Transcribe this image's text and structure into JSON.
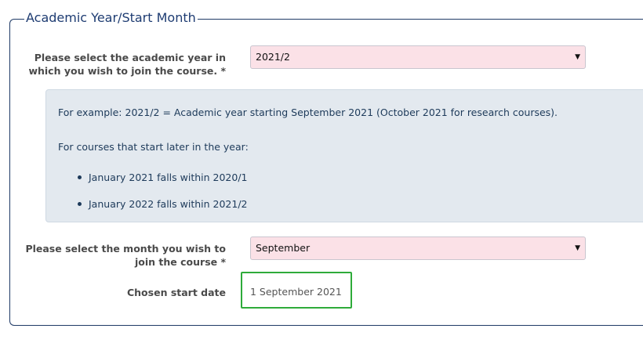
{
  "fieldset": {
    "legend": "Academic Year/Start Month"
  },
  "academic_year": {
    "label": "Please select the academic year in which you wish to join the course. *",
    "selected": "2021/2"
  },
  "info": {
    "example": "For example: 2021/2 = Academic year starting September 2021 (October 2021 for research courses).",
    "later_intro": "For courses that start later in the year:",
    "bullets": [
      "January 2021 falls within 2020/1",
      "January 2022 falls within 2021/2"
    ]
  },
  "start_month": {
    "label": "Please select the month you wish to join the course *",
    "selected": "September"
  },
  "chosen_start_date": {
    "label": "Chosen start date",
    "value": "1 September 2021"
  },
  "colors": {
    "select_background": "#fbe1e7",
    "info_background": "#e3e9ef",
    "highlight_border": "#2eab3a",
    "legend_text": "#1e3c72"
  },
  "icons": {
    "dropdown": "triangle-down"
  }
}
